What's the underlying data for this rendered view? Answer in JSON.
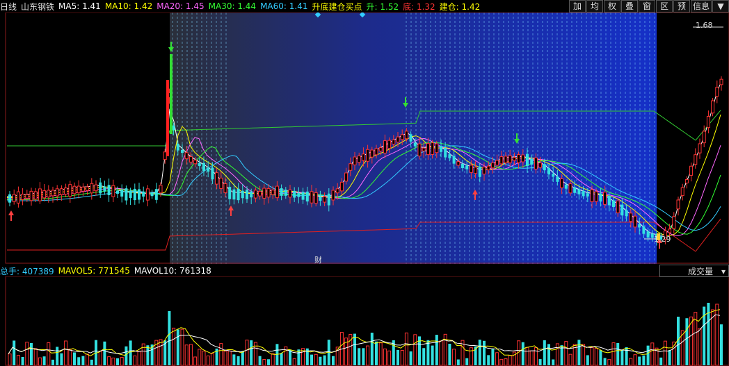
{
  "header": {
    "period": "日线",
    "stock_name": "山东钢铁",
    "ma5": "MA5: 1.41",
    "ma10": "MA10: 1.42",
    "ma20": "MA20: 1.45",
    "ma30": "MA30: 1.44",
    "ma60": "MA60: 1.41",
    "indicator": "升底建仓买点",
    "rise": "升: 1.52",
    "bottom": "底: 1.32",
    "build": "建仓: 1.42",
    "colors": {
      "ma5": "#ffffff",
      "ma10": "#ffff00",
      "ma20": "#ff66ff",
      "ma30": "#33ff33",
      "ma60": "#33ccff",
      "rise": "#33ff33",
      "bottom": "#ff3333",
      "build": "#ffff00"
    }
  },
  "toolbar": {
    "buttons": [
      "加",
      "均",
      "权",
      "叠",
      "窗",
      "区",
      "预",
      "信息",
      "▼"
    ]
  },
  "price_chart": {
    "high_label": "1.68",
    "low_label": "1.29",
    "event_label": "财"
  },
  "volume_header": {
    "total": "总手: 407389",
    "mavol5": "MAVOL5: 771545",
    "mavol10": "MAVOL10: 761318",
    "indicator_select": "成交量",
    "dropdown_icon": "chevron-down-icon"
  },
  "chart_data": {
    "type": "candlestick",
    "y_range": [
      1.25,
      1.7
    ],
    "price_labels": {
      "high": 1.68,
      "low": 1.29
    },
    "legend": [
      "MA5",
      "MA10",
      "MA20",
      "MA30",
      "MA60",
      "升",
      "底",
      "建仓"
    ]
  }
}
